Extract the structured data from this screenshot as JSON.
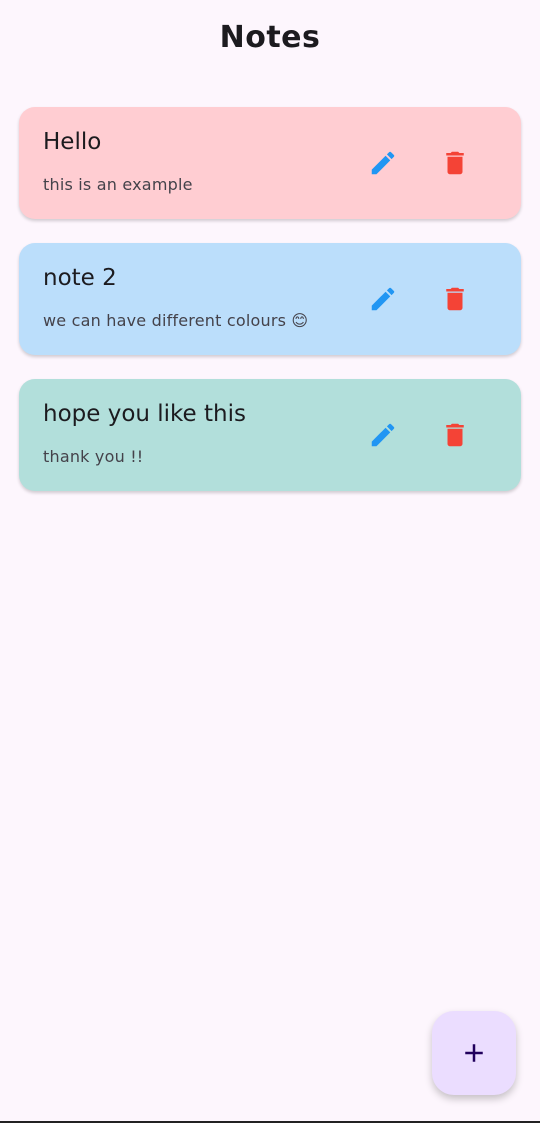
{
  "app": {
    "title": "Notes"
  },
  "notes": [
    {
      "title": "Hello",
      "body": "this is an example",
      "color": "#ffcdd2",
      "edit_icon": "pencil-icon",
      "delete_icon": "trash-icon"
    },
    {
      "title": "note 2",
      "body": "we can have different colours 😊",
      "color": "#bbdefb",
      "edit_icon": "pencil-icon",
      "delete_icon": "trash-icon"
    },
    {
      "title": "hope you like this",
      "body": "thank you !!",
      "color": "#b2dfdb",
      "edit_icon": "pencil-icon",
      "delete_icon": "trash-icon"
    }
  ],
  "colors": {
    "background": "#fdf6fd",
    "edit_icon": "#2196f3",
    "delete_icon": "#f44336",
    "fab_background": "#ebddff",
    "fab_icon": "#21005d"
  },
  "fab": {
    "icon": "plus-icon"
  }
}
